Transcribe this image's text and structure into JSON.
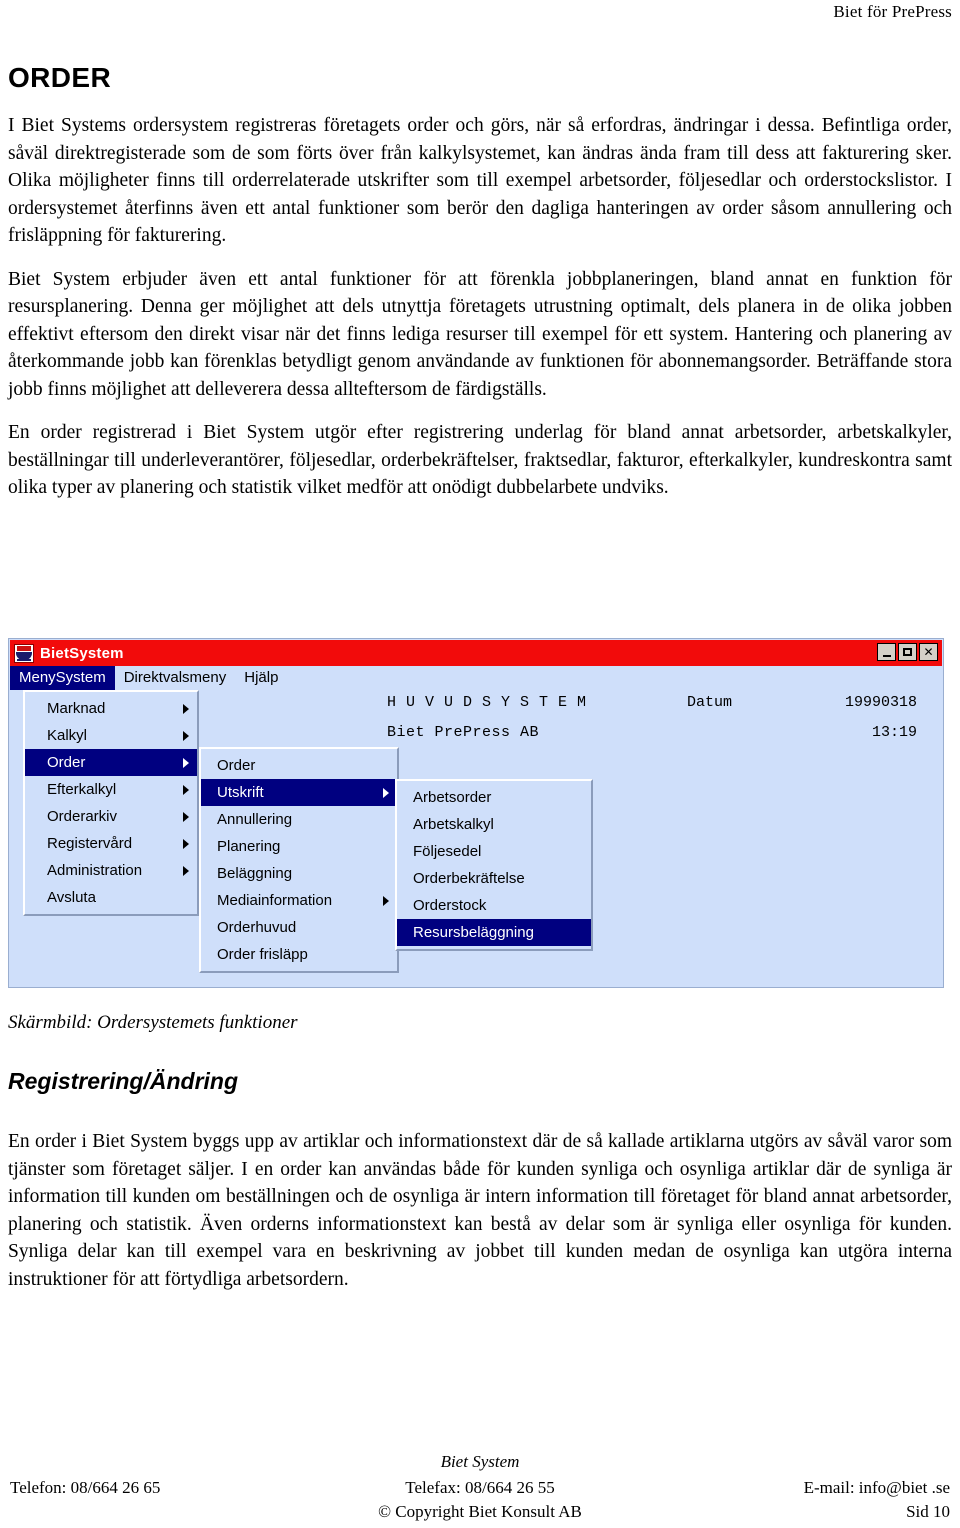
{
  "running_header": "Biet för PrePress",
  "page_title": "ORDER",
  "paragraphs": {
    "p1": "I Biet Systems ordersystem registreras företagets order och görs, när så erfordras, ändringar i dessa. Befintliga order, såväl direktregisterade som de som förts över från kalkylsystemet, kan ändras ända fram till dess att fakturering sker. Olika möjligheter finns till orderrelaterade utskrifter som till exempel arbetsorder, följesedlar och orderstockslistor. I ordersystemet återfinns även ett antal funktioner som berör den dagliga hanteringen av order såsom annullering och frisläppning för fakturering.",
    "p2": "Biet System erbjuder även ett antal funktioner för att förenkla jobbplaneringen, bland annat en funktion för resursplanering. Denna ger möjlighet att dels utnyttja företagets utrustning optimalt, dels planera in de olika jobben effektivt eftersom den direkt visar när det finns lediga resurser till exempel för ett system. Hantering och planering av återkommande jobb kan förenklas betydligt genom användande av funktionen för abonnemangsorder. Beträffande stora jobb finns möjlighet att delleverera dessa allteftersom de färdigställs.",
    "p3": "En order registrerad i Biet System utgör efter registrering underlag för bland annat arbetsorder, arbetskalkyler, beställningar till underleverantörer, följesedlar, orderbekräftelser, fraktsedlar, fakturor, efterkalkyler, kundreskontra samt olika typer av planering och statistik vilket medför att onödigt dubbelarbete undviks.",
    "p4": "En order i Biet System byggs upp av artiklar och informationstext där de så kallade artiklarna utgörs av såväl varor som tjänster som företaget säljer. I en order kan användas både för kunden synliga och osynliga artiklar där de synliga är information till kunden om beställningen och de osynliga är intern information till företaget för bland annat arbetsorder, planering och statistik. Även orderns informationstext kan bestå av delar som är synliga eller osynliga för kunden. Synliga delar kan till exempel vara en beskrivning av jobbet till kunden medan de osynliga kan utgöra interna instruktioner för att förtydliga arbetsordern."
  },
  "screenshot": {
    "window_title": "BietSystem",
    "title_icon": "bietsystem-logo-icon",
    "titlebar_color": "#f20b0b",
    "window_background": "#cfdffa",
    "highlight_color": "#000080",
    "window_buttons": [
      {
        "name": "minimize",
        "label": "_"
      },
      {
        "name": "maximize",
        "label": "□"
      },
      {
        "name": "close",
        "label": "✕"
      }
    ],
    "menubar": [
      {
        "label": "MenySystem",
        "active": true
      },
      {
        "label": "Direktvalsmeny",
        "active": false
      },
      {
        "label": "Hjälp",
        "active": false
      }
    ],
    "menu_level1": [
      {
        "label": "Marknad",
        "arrow": true,
        "selected": false
      },
      {
        "label": "Kalkyl",
        "arrow": true,
        "selected": false
      },
      {
        "label": "Order",
        "arrow": true,
        "selected": true
      },
      {
        "label": "Efterkalkyl",
        "arrow": true,
        "selected": false
      },
      {
        "label": "Orderarkiv",
        "arrow": true,
        "selected": false
      },
      {
        "label": "Registervård",
        "arrow": true,
        "selected": false
      },
      {
        "label": "Administration",
        "arrow": true,
        "selected": false
      },
      {
        "label": "Avsluta",
        "arrow": false,
        "selected": false
      }
    ],
    "menu_level2": [
      {
        "label": "Order",
        "arrow": false,
        "selected": false
      },
      {
        "label": "Utskrift",
        "arrow": true,
        "selected": true
      },
      {
        "label": "Annullering",
        "arrow": false,
        "selected": false
      },
      {
        "label": "Planering",
        "arrow": false,
        "selected": false
      },
      {
        "label": "Beläggning",
        "arrow": false,
        "selected": false
      },
      {
        "label": "Mediainformation",
        "arrow": true,
        "selected": false
      },
      {
        "label": "Orderhuvud",
        "arrow": false,
        "selected": false
      },
      {
        "label": "Order frisläpp",
        "arrow": false,
        "selected": false
      }
    ],
    "menu_level3": [
      {
        "label": "Arbetsorder",
        "arrow": false,
        "selected": false
      },
      {
        "label": "Arbetskalkyl",
        "arrow": false,
        "selected": false
      },
      {
        "label": "Följesedel",
        "arrow": false,
        "selected": false
      },
      {
        "label": "Orderbekräftelse",
        "arrow": false,
        "selected": false
      },
      {
        "label": "Orderstock",
        "arrow": false,
        "selected": false
      },
      {
        "label": "Resursbeläggning",
        "arrow": false,
        "selected": true
      }
    ],
    "client": {
      "heading": "H U V U D S Y S T E M",
      "date_label": "Datum",
      "date_value": "19990318",
      "company": "Biet PrePress AB",
      "time_value": "13:19"
    }
  },
  "caption": "Skärmbild: Ordersystemets funktioner",
  "section_title": "Registrering/Ändring",
  "footer": {
    "brand": "Biet System",
    "phone": "Telefon: 08/664 26 65",
    "fax": "Telefax: 08/664 26 55",
    "email": "E-mail: info@biet .se",
    "copyright": "© Copyright Biet Konsult AB",
    "page_number": "Sid 10"
  }
}
